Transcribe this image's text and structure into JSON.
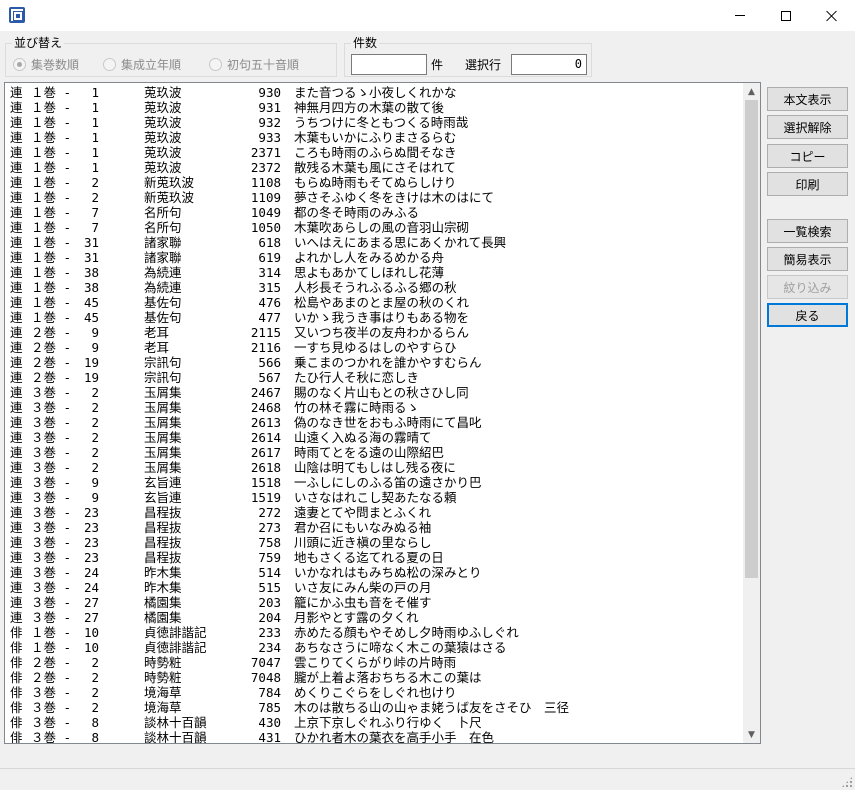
{
  "window": {
    "app_icon": "app-icon"
  },
  "sort": {
    "title": "並び替え",
    "options": [
      "集巻数順",
      "集成立年順",
      "初句五十音順"
    ],
    "selected_index": 0
  },
  "count": {
    "title": "件数",
    "value": "",
    "unit": "件",
    "selected_label": "選択行",
    "selected_value": "0"
  },
  "buttons": {
    "show_text": "本文表示",
    "clear_selection": "選択解除",
    "copy": "コピー",
    "print": "印刷",
    "list_search": "一覧検索",
    "simple_view": "簡易表示",
    "filter": "紋り込み",
    "back": "戻る"
  },
  "rows": [
    [
      "連",
      "１巻 -",
      "1",
      "莵玖波",
      "930",
      "また音つるゝ小夜しくれかな"
    ],
    [
      "連",
      "１巻 -",
      "1",
      "莵玖波",
      "931",
      "神無月四方の木葉の散て後"
    ],
    [
      "連",
      "１巻 -",
      "1",
      "莵玖波",
      "932",
      "うちつけに冬ともつくる時雨哉"
    ],
    [
      "連",
      "１巻 -",
      "1",
      "莵玖波",
      "933",
      "木葉もいかにふりまさるらむ"
    ],
    [
      "連",
      "１巻 -",
      "1",
      "莵玖波",
      "2371",
      "ころも時雨のふらぬ間そなき"
    ],
    [
      "連",
      "１巻 -",
      "1",
      "莵玖波",
      "2372",
      "散残る木葉も風にさそはれて"
    ],
    [
      "連",
      "１巻 -",
      "2",
      "新莵玖波",
      "1108",
      "もらぬ時雨もそてぬらしけり"
    ],
    [
      "連",
      "１巻 -",
      "2",
      "新莵玖波",
      "1109",
      "夢さそふゆく冬をきけは木のはにて"
    ],
    [
      "連",
      "１巻 -",
      "7",
      "名所句",
      "1049",
      "都の冬そ時雨のみふる"
    ],
    [
      "連",
      "１巻 -",
      "7",
      "名所句",
      "1050",
      "木葉吹あらしの風の音羽山宗砌"
    ],
    [
      "連",
      "１巻 -",
      "31",
      "諸家聯",
      "618",
      "いへはえにあまる思にあくかれて長興"
    ],
    [
      "連",
      "１巻 -",
      "31",
      "諸家聯",
      "619",
      "よれかし人をみるめかる舟"
    ],
    [
      "連",
      "１巻 -",
      "38",
      "為続連",
      "314",
      "思よもあかてしほれし花薄"
    ],
    [
      "連",
      "１巻 -",
      "38",
      "為続連",
      "315",
      "人杉長そうれふるふる郷の秋"
    ],
    [
      "連",
      "１巻 -",
      "45",
      "基佐句",
      "476",
      "松島やあまのとま屋の秋のくれ"
    ],
    [
      "連",
      "１巻 -",
      "45",
      "基佐句",
      "477",
      "いかゝ我うき事はりもある物を"
    ],
    [
      "連",
      "２巻 -",
      "9",
      "老耳",
      "2115",
      "又いつち夜半の友舟わかるらん"
    ],
    [
      "連",
      "２巻 -",
      "9",
      "老耳",
      "2116",
      "一すち見ゆるはしのやすらひ"
    ],
    [
      "連",
      "２巻 -",
      "19",
      "宗訊句",
      "566",
      "乗こまのつかれを誰かやすむらん"
    ],
    [
      "連",
      "２巻 -",
      "19",
      "宗訊句",
      "567",
      "たひ行人そ秋に恋しき"
    ],
    [
      "連",
      "３巻 -",
      "2",
      "玉屑集",
      "2467",
      "賜のなく片山もとの秋さひし同"
    ],
    [
      "連",
      "３巻 -",
      "2",
      "玉屑集",
      "2468",
      "竹の林そ霧に時雨るゝ"
    ],
    [
      "連",
      "３巻 -",
      "2",
      "玉屑集",
      "2613",
      "偽のなき世をおもふ時雨にて昌叱"
    ],
    [
      "連",
      "３巻 -",
      "2",
      "玉屑集",
      "2614",
      "山遠く入ぬる海の霧晴て"
    ],
    [
      "連",
      "３巻 -",
      "2",
      "玉屑集",
      "2617",
      "時雨てとをる遠の山際紹巴"
    ],
    [
      "連",
      "３巻 -",
      "2",
      "玉屑集",
      "2618",
      "山陰は明てもしはし残る夜に"
    ],
    [
      "連",
      "３巻 -",
      "9",
      "玄旨連",
      "1518",
      "一ふしにしのふる笛の遠さかり巴"
    ],
    [
      "連",
      "３巻 -",
      "9",
      "玄旨連",
      "1519",
      "いさなはれこし契あたなる頼"
    ],
    [
      "連",
      "３巻 -",
      "23",
      "昌程抜",
      "272",
      "遠妻とてや問まとふくれ"
    ],
    [
      "連",
      "３巻 -",
      "23",
      "昌程抜",
      "273",
      "君か召にもいなみぬる袖"
    ],
    [
      "連",
      "３巻 -",
      "23",
      "昌程抜",
      "758",
      "川頭に近き槇の里ならし"
    ],
    [
      "連",
      "３巻 -",
      "23",
      "昌程抜",
      "759",
      "地もさくる迄てれる夏の日"
    ],
    [
      "連",
      "３巻 -",
      "24",
      "昨木集",
      "514",
      "いかなれはもみちぬ松の深みとり"
    ],
    [
      "連",
      "３巻 -",
      "24",
      "昨木集",
      "515",
      "いさ友にみん柴の戸の月"
    ],
    [
      "連",
      "３巻 -",
      "27",
      "橘園集",
      "203",
      "籠にかふ虫も音をそ催す"
    ],
    [
      "連",
      "３巻 -",
      "27",
      "橘園集",
      "204",
      "月影やとす露の夕くれ"
    ],
    [
      "俳",
      "１巻 -",
      "10",
      "貞徳誹諧記",
      "233",
      "赤めたる顔もやそめし夕時雨ゆふしぐれ"
    ],
    [
      "俳",
      "１巻 -",
      "10",
      "貞徳誹諧記",
      "234",
      "あちなさうに啼なく木この葉猿はさる"
    ],
    [
      "俳",
      "２巻 -",
      "2",
      "時勢粧",
      "7047",
      "雲こりてくらがり峠の片時雨"
    ],
    [
      "俳",
      "２巻 -",
      "2",
      "時勢粧",
      "7048",
      "朧が上着よ落おちちる木この葉は"
    ],
    [
      "俳",
      "３巻 -",
      "2",
      "境海草",
      "784",
      "めくりこぐらをしぐれ也けり"
    ],
    [
      "俳",
      "３巻 -",
      "2",
      "境海草",
      "785",
      "木のは散ちる山の山ゃま姥うば友をさそひ　三径"
    ],
    [
      "俳",
      "３巻 -",
      "8",
      "談林十百韻",
      "430",
      "上京下京しぐれふり行ゆく　卜尺"
    ],
    [
      "俳",
      "３巻 -",
      "8",
      "談林十百韻",
      "431",
      "ひかれ者木の葉衣を高手小手　在色"
    ]
  ]
}
